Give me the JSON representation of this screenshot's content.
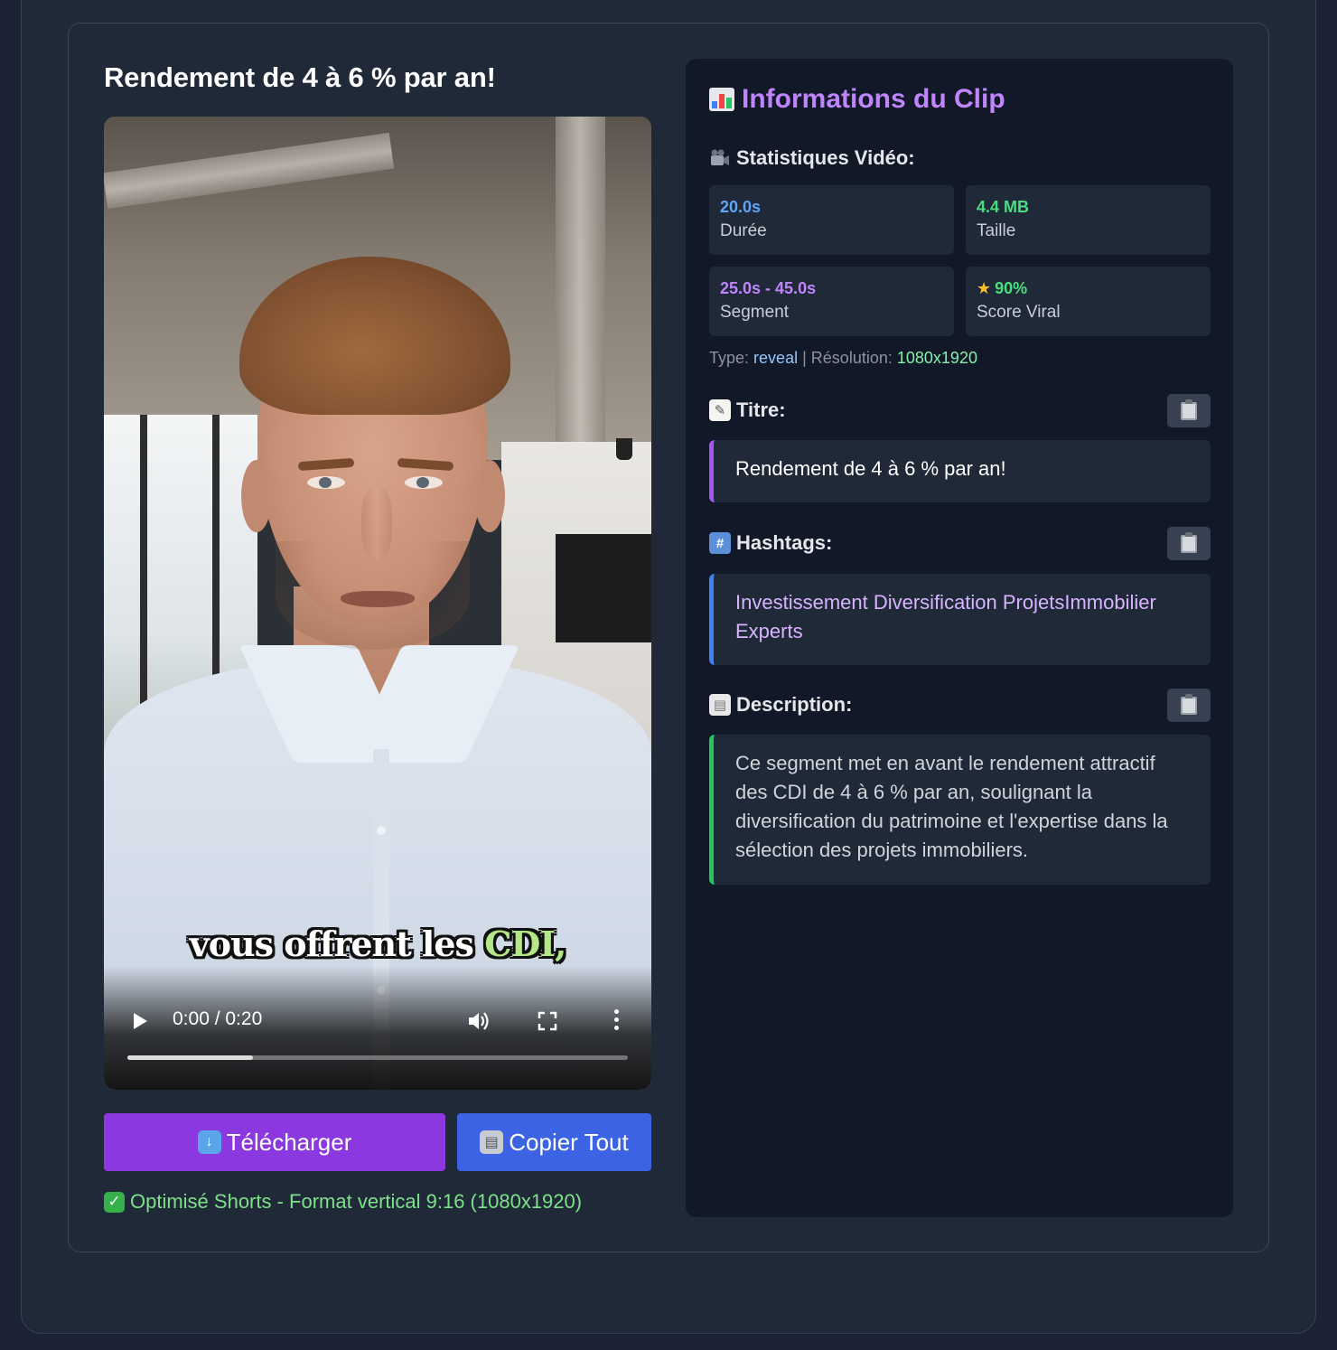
{
  "clip": {
    "title": "Rendement de 4 à 6 % par an!"
  },
  "video": {
    "caption_white": "vous offrent les",
    "caption_highlight": "CDI,",
    "time": "0:00 / 0:20",
    "progress_fraction": 0.25
  },
  "actions": {
    "download_label": "Télécharger",
    "copy_all_label": "Copier Tout",
    "optimized_note": "Optimisé Shorts - Format vertical 9:16 (1080x1920)"
  },
  "info": {
    "heading": "Informations du Clip",
    "stats_heading": "Statistiques Vidéo:",
    "stats": [
      {
        "value": "20.0s",
        "label": "Durée",
        "color": "#60a5fa"
      },
      {
        "value": "4.4 MB",
        "label": "Taille",
        "color": "#4ade80"
      },
      {
        "value": "25.0s - 45.0s",
        "label": "Segment",
        "color": "#c084fc"
      },
      {
        "value": "90%",
        "label": "Score Viral",
        "color": "#4ade80"
      }
    ],
    "type_label": "Type:",
    "type_value": "reveal",
    "separator": "|",
    "resolution_label": "Résolution:",
    "resolution_value": "1080x1920",
    "title_heading": "Titre:",
    "title_text": "Rendement de 4 à 6 % par an!",
    "hashtags_heading": "Hashtags:",
    "hashtags_text": "Investissement Diversification ProjetsImmobilier Experts",
    "description_heading": "Description:",
    "description_text": "Ce segment met en avant le rendement attractif des CDI de 4 à 6 % par an, soulignant la diversification du patrimoine et l'expertise dans la sélection des projets immobiliers."
  },
  "colors": {
    "accent_purple": "#8b38e0",
    "accent_blue": "#3b63e4",
    "success_green": "#7ee08b"
  },
  "icons": {
    "download": "download-icon",
    "copy": "clipboard-icon",
    "check": "check-icon",
    "chart": "bar-chart-icon",
    "camera": "video-camera-icon",
    "memo": "memo-icon",
    "hash": "hash-icon",
    "document": "document-icon",
    "star": "star-icon"
  }
}
